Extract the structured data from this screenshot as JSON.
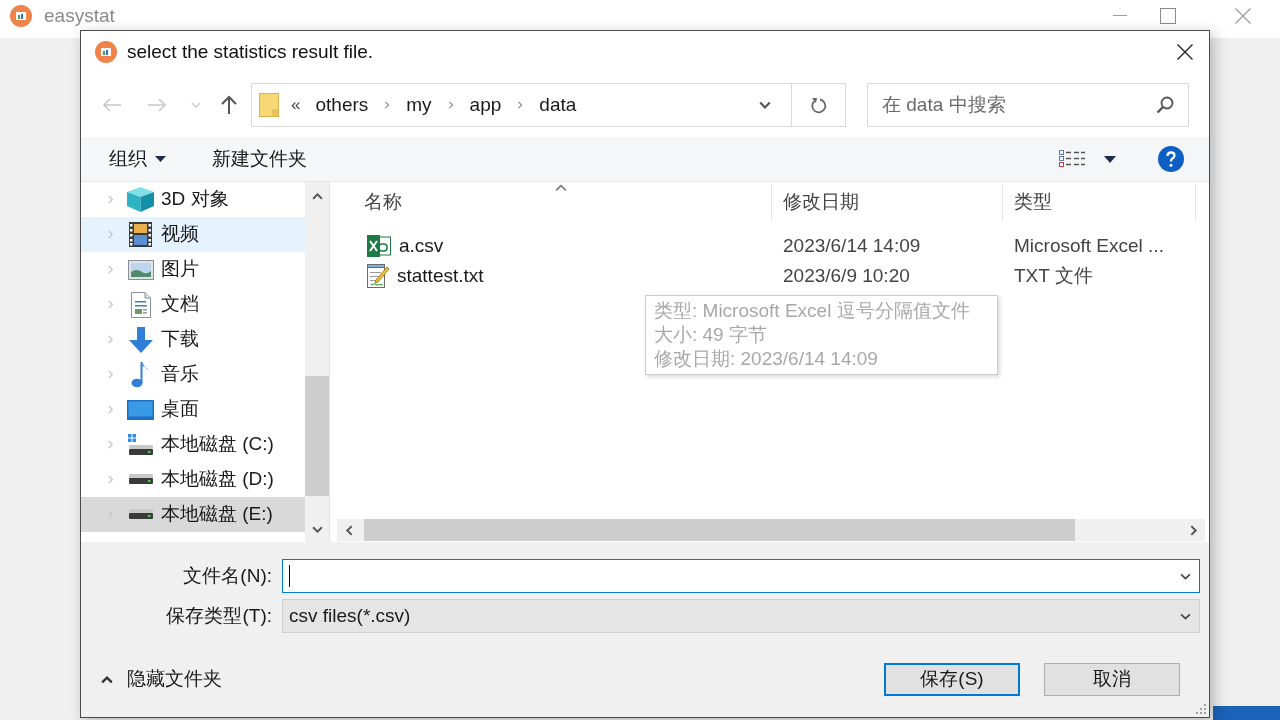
{
  "app_window": {
    "title": "easystat"
  },
  "dialog": {
    "title": "select the statistics result file."
  },
  "nav_buttons": [
    {
      "kind": "back",
      "disabled": true
    },
    {
      "kind": "forward",
      "disabled": true
    },
    {
      "kind": "recent",
      "disabled": true
    },
    {
      "kind": "up",
      "disabled": false
    }
  ],
  "address_bar": {
    "overflow_marker": "«",
    "path": [
      "others",
      "my",
      "app",
      "data"
    ]
  },
  "search": {
    "placeholder": "在 data 中搜索"
  },
  "toolbar": {
    "organize": "组织",
    "new_folder": "新建文件夹"
  },
  "nav_pane": {
    "items": [
      {
        "label": "3D 对象",
        "kind": "objects3d",
        "hovered": false,
        "selected": false
      },
      {
        "label": "视频",
        "kind": "videos",
        "hovered": true,
        "selected": false
      },
      {
        "label": "图片",
        "kind": "pictures",
        "hovered": false,
        "selected": false
      },
      {
        "label": "文档",
        "kind": "documents",
        "hovered": false,
        "selected": false
      },
      {
        "label": "下载",
        "kind": "downloads",
        "hovered": false,
        "selected": false
      },
      {
        "label": "音乐",
        "kind": "music",
        "hovered": false,
        "selected": false
      },
      {
        "label": "桌面",
        "kind": "desktop",
        "hovered": false,
        "selected": false
      },
      {
        "label": "本地磁盘 (C:)",
        "kind": "system_drive",
        "hovered": false,
        "selected": false
      },
      {
        "label": "本地磁盘 (D:)",
        "kind": "drive",
        "hovered": false,
        "selected": false
      },
      {
        "label": "本地磁盘 (E:)",
        "kind": "drive",
        "hovered": false,
        "selected": true
      }
    ]
  },
  "file_list": {
    "columns": [
      {
        "label": "名称",
        "sorted": true
      },
      {
        "label": "修改日期",
        "sorted": false
      },
      {
        "label": "类型",
        "sorted": false
      }
    ],
    "rows": [
      {
        "name": "a.csv",
        "kind": "csv",
        "modified": "2023/6/14 14:09",
        "type": "Microsoft Excel ..."
      },
      {
        "name": "stattest.txt",
        "kind": "txt",
        "modified": "2023/6/9 10:20",
        "type": "TXT 文件"
      }
    ]
  },
  "tooltip": {
    "lines": [
      "类型: Microsoft Excel 逗号分隔值文件",
      "大小: 49 字节",
      "修改日期: 2023/6/14 14:09"
    ]
  },
  "file_name": {
    "label": "文件名(N):",
    "focused": true
  },
  "file_type": {
    "label": "保存类型(T):",
    "value": "csv files(*.csv)"
  },
  "hide_folders": "隐藏文件夹",
  "buttons": [
    {
      "label": "保存(S)",
      "default": true
    },
    {
      "label": "取消",
      "default": false
    }
  ]
}
